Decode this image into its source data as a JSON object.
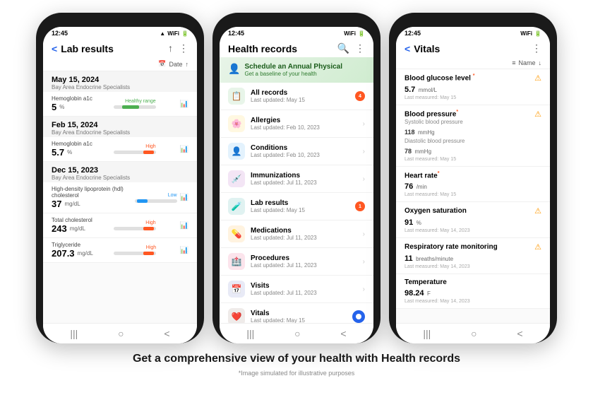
{
  "phones": [
    {
      "id": "lab-results",
      "time": "12:45",
      "header_back": "<",
      "header_title": "Lab results",
      "header_menu": "⋮",
      "filter_label": "Date",
      "sections": [
        {
          "date": "May 15, 2024",
          "provider": "Bay Area Endocrine Specialists",
          "items": [
            {
              "name": "Hemoglobin a1c",
              "value": "5",
              "unit": "%",
              "range_type": "healthy",
              "range_label": "Healthy range"
            }
          ]
        },
        {
          "date": "Feb 15, 2024",
          "provider": "Bay Area Endocrine Specialists",
          "items": [
            {
              "name": "Hemoglobin a1c",
              "value": "5.7",
              "unit": "%",
              "range_type": "high",
              "range_label": "High"
            }
          ]
        },
        {
          "date": "Dec 15, 2023",
          "provider": "Bay Area Endocrine Specialists",
          "items": [
            {
              "name": "High-density lipoprotein (hdl) cholesterol",
              "value": "37",
              "unit": "mg/dL",
              "range_type": "low",
              "range_label": "Low"
            },
            {
              "name": "Total cholesterol",
              "value": "243",
              "unit": "mg/dL",
              "range_type": "high",
              "range_label": "High"
            },
            {
              "name": "Triglyceride",
              "value": "207.3",
              "unit": "mg/dL",
              "range_type": "high",
              "range_label": "High"
            }
          ]
        }
      ]
    },
    {
      "id": "health-records",
      "time": "12:45",
      "header_title": "Health records",
      "header_search": "🔍",
      "header_menu": "⋮",
      "banner_icon": "👤",
      "banner_title": "Schedule an Annual Physical",
      "banner_sub": "Get a baseline of your health",
      "records": [
        {
          "icon": "📋",
          "icon_class": "green",
          "name": "All records",
          "date": "Last updated: May 15",
          "badge": "4"
        },
        {
          "icon": "🌸",
          "icon_class": "yellow",
          "name": "Allergies",
          "date": "Last updated: Feb 10, 2023",
          "badge": ""
        },
        {
          "icon": "👤",
          "icon_class": "blue",
          "name": "Conditions",
          "date": "Last updated: Feb 10, 2023",
          "badge": ""
        },
        {
          "icon": "💉",
          "icon_class": "purple",
          "name": "Immunizations",
          "date": "Last updated: Jul 11, 2023",
          "badge": ""
        },
        {
          "icon": "🧪",
          "icon_class": "teal",
          "name": "Lab results",
          "date": "Last updated: May 15",
          "badge": "1"
        },
        {
          "icon": "💊",
          "icon_class": "orange",
          "name": "Medications",
          "date": "Last updated: Jul 11, 2023",
          "badge": ""
        },
        {
          "icon": "🏥",
          "icon_class": "pink",
          "name": "Procedures",
          "date": "Last updated: Jul 11, 2023",
          "badge": ""
        },
        {
          "icon": "📅",
          "icon_class": "indigo",
          "name": "Visits",
          "date": "Last updated: Jul 11, 2023",
          "badge": ""
        },
        {
          "icon": "❤️",
          "icon_class": "brown",
          "name": "Vitals",
          "date": "Last updated: May 15",
          "badge": ""
        }
      ]
    },
    {
      "id": "vitals",
      "time": "12:45",
      "header_back": "<",
      "header_title": "Vitals",
      "header_menu": "⋮",
      "filter_label": "Name",
      "vitals": [
        {
          "name": "Blood glucose level",
          "asterisk": true,
          "alert": true,
          "value": "5.7",
          "unit": "mmol/L",
          "date": "Last measured: May 15"
        },
        {
          "name": "Blood pressure",
          "asterisk": true,
          "alert": true,
          "sub1_label": "Systolic blood pressure",
          "sub1_value": "118",
          "sub1_unit": "mmHg",
          "sub2_label": "Diastolic blood pressure",
          "sub2_value": "78",
          "sub2_unit": "mmHg",
          "date": "Last measured: May 15"
        },
        {
          "name": "Heart rate",
          "asterisk": true,
          "alert": false,
          "value": "76",
          "unit": "/min",
          "date": "Last measured: May 15"
        },
        {
          "name": "Oxygen saturation",
          "asterisk": false,
          "alert": true,
          "value": "91",
          "unit": "%",
          "date": "Last measured: May 14, 2023"
        },
        {
          "name": "Respiratory rate monitoring",
          "asterisk": false,
          "alert": true,
          "value": "11",
          "unit": "breaths/minute",
          "date": "Last measured: May 14, 2023"
        },
        {
          "name": "Temperature",
          "asterisk": false,
          "alert": false,
          "value": "98.24",
          "unit": "F",
          "date": "Last measured: May 14, 2023"
        }
      ]
    }
  ],
  "caption": "Get a comprehensive view of your health with Health records",
  "subcaption": "*Image simulated for illustrative purposes",
  "nav_buttons": [
    "|||",
    "○",
    "<"
  ]
}
